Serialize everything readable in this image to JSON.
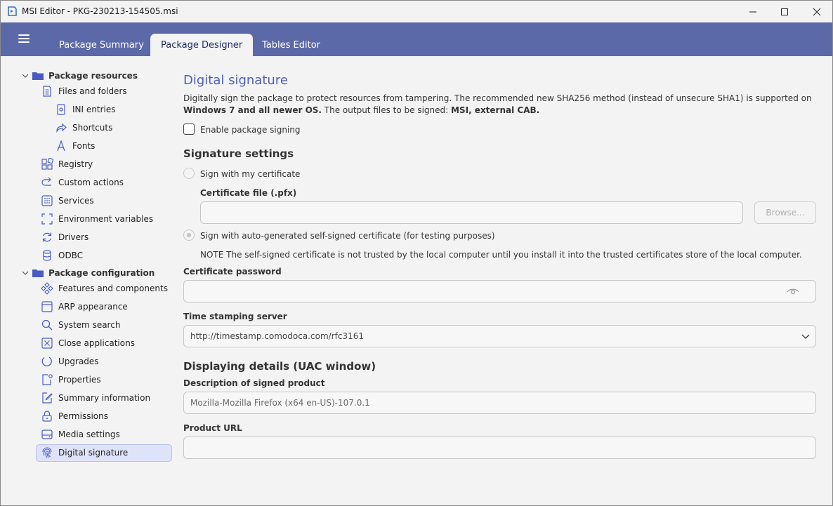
{
  "window": {
    "title": "MSI Editor - PKG-230213-154505.msi"
  },
  "tabs": [
    {
      "label": "Package Summary"
    },
    {
      "label": "Package Designer"
    },
    {
      "label": "Tables Editor"
    }
  ],
  "sidebar": {
    "group_resources": "Package resources",
    "group_configuration": "Package configuration",
    "items": {
      "files": "Files and folders",
      "ini": "INI entries",
      "shortcuts": "Shortcuts",
      "fonts": "Fonts",
      "registry": "Registry",
      "custom_actions": "Custom actions",
      "services": "Services",
      "env": "Environment variables",
      "drivers": "Drivers",
      "odbc": "ODBC",
      "features": "Features and components",
      "arp": "ARP appearance",
      "search": "System search",
      "close_apps": "Close applications",
      "upgrades": "Upgrades",
      "properties": "Properties",
      "summary": "Summary information",
      "permissions": "Permissions",
      "media": "Media settings",
      "digital_signature": "Digital signature"
    }
  },
  "main": {
    "title": "Digital signature",
    "desc_part1": "Digitally sign the package to protect resources from tampering. The recommended new SHA256 method (instead of unsecure SHA1) is supported on ",
    "desc_bold1": "Windows 7 and all newer OS.",
    "desc_part2": " The output files to be signed: ",
    "desc_bold2": "MSI, external CAB.",
    "enable_signing": "Enable package signing",
    "signature_settings": "Signature settings",
    "sign_with_my_cert": "Sign with my certificate",
    "cert_file_label": "Certificate file (.pfx)",
    "cert_file_value": "",
    "browse": "Browse...",
    "sign_self_signed": "Sign with auto-generated self-signed certificate (for testing purposes)",
    "note": "NOTE The self-signed certificate is not trusted by the local computer until you install it into the trusted certificates store of the local computer.",
    "cert_password_label": "Certificate password",
    "cert_password_value": "",
    "timestamp_label": "Time stamping server",
    "timestamp_value": "http://timestamp.comodoca.com/rfc3161",
    "displaying_details": "Displaying details (UAC window)",
    "description_label": "Description of signed product",
    "description_value": "Mozilla-Mozilla Firefox (x64 en-US)-107.0.1",
    "product_url_label": "Product URL",
    "product_url_value": ""
  },
  "colors": {
    "header": "#5b69a8",
    "accent": "#4f5fb8",
    "selected": "#dfe3fa"
  }
}
